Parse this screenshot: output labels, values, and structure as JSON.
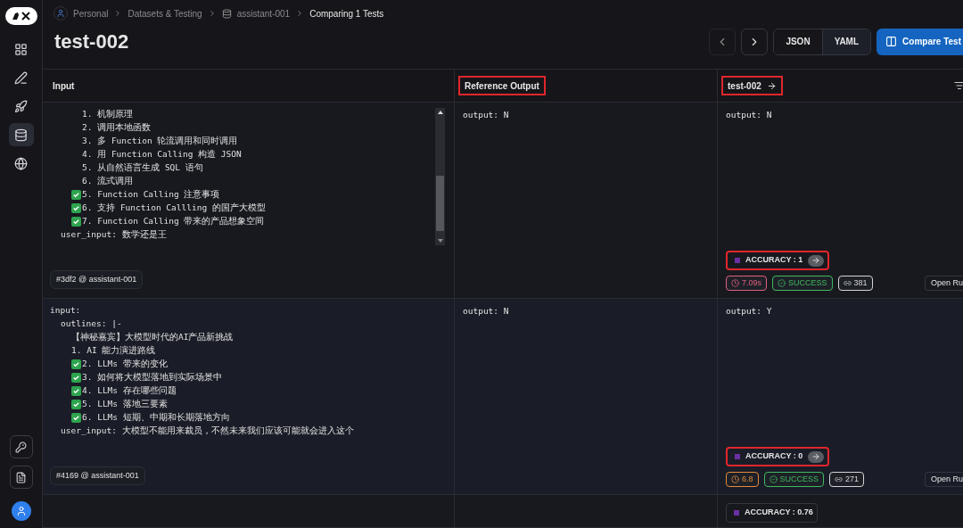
{
  "breadcrumb": [
    {
      "label": "Personal",
      "kind": "user"
    },
    {
      "label": "Datasets & Testing",
      "kind": "plain"
    },
    {
      "label": "assistant-001",
      "kind": "database"
    },
    {
      "label": "Comparing 1 Tests",
      "kind": "current"
    }
  ],
  "title": "test-002",
  "toolbar": {
    "formats": [
      {
        "label": "JSON",
        "selected": false
      },
      {
        "label": "YAML",
        "selected": true
      }
    ],
    "compare_button": "Compare Test"
  },
  "sidebar": {
    "top": [
      {
        "kind": "grid",
        "selected": false
      },
      {
        "kind": "pen",
        "selected": false
      },
      {
        "kind": "rocket",
        "selected": false
      },
      {
        "kind": "database",
        "selected": true
      },
      {
        "kind": "globe",
        "selected": false
      }
    ],
    "bottom": [
      {
        "kind": "key"
      },
      {
        "kind": "file"
      }
    ]
  },
  "columns": [
    {
      "label": "Input",
      "highlighted": false,
      "arrow": false
    },
    {
      "label": "Reference Output",
      "highlighted": true,
      "arrow": false
    },
    {
      "label": "test-002",
      "highlighted": true,
      "arrow": true
    }
  ],
  "rows": [
    {
      "input": [
        {
          "children": [
            {
              "children": [
                {
                  "children": [
                    {
                      "text": "1. 机制原理",
                      "checked": false
                    },
                    {
                      "text": "2. 调用本地函数",
                      "checked": false
                    },
                    {
                      "text": "3. 多 Function 轮流调用和同时调用",
                      "checked": false
                    },
                    {
                      "text": "4. 用 Function Calling 构造 JSON",
                      "checked": false
                    },
                    {
                      "text": "5. 从自然语言生成 SQL 语句",
                      "checked": false
                    },
                    {
                      "text": "6. 流式调用",
                      "checked": false
                    }
                  ]
                },
                {
                  "text": "5. Function Calling 注意事项",
                  "checked": true
                },
                {
                  "text": "6. 支持 Function Callling 的国产大模型",
                  "checked": true
                },
                {
                  "text": "7. Function Calling 带来的产品想象空间",
                  "checked": true
                }
              ]
            },
            {
              "text": "user_input: 数学还是王",
              "checked": false
            }
          ]
        }
      ],
      "scrollbar": true,
      "tag": "#3df2 @ assistant-001",
      "reference": "output: N",
      "output": "output: N",
      "accuracy": {
        "label": "ACCURACY : 1",
        "highlighted": true,
        "arrow": true
      },
      "stats": [
        {
          "kind": "latency",
          "text": "7.09s",
          "color": "#e0607e"
        },
        {
          "kind": "status",
          "text": "SUCCESS",
          "color": "#3fb95f"
        },
        {
          "kind": "tokens",
          "text": "381",
          "color": "#d4d4d8"
        }
      ],
      "open_run": "Open Ru"
    },
    {
      "input": [
        {
          "text": "input:",
          "checked": false,
          "children": [
            {
              "text": "outlines: |-",
              "checked": false,
              "children": [
                {
                  "text": "【神秘嘉宾】大模型时代的AI产品新挑战",
                  "checked": false
                },
                {
                  "text": "1. AI 能力演进路线",
                  "checked": false
                },
                {
                  "text": "2. LLMs 带来的变化",
                  "checked": true
                },
                {
                  "text": "3. 如何将大模型落地到实际场景中",
                  "checked": true
                },
                {
                  "text": "4. LLMs 存在哪些问题",
                  "checked": true
                },
                {
                  "text": "5. LLMs 落地三要素",
                  "checked": true
                },
                {
                  "text": "6. LLMs 短期、中期和长期落地方向",
                  "checked": true
                }
              ]
            },
            {
              "text": "user_input: 大模型不能用来裁员，不然未来我们应该可能就会进入这个",
              "checked": false
            }
          ]
        }
      ],
      "scrollbar": false,
      "tag": "#4169 @ assistant-001",
      "reference": "output: N",
      "output": "output: Y",
      "accuracy": {
        "label": "ACCURACY : 0",
        "highlighted": true,
        "arrow": true
      },
      "stats": [
        {
          "kind": "latency",
          "text": "6.8",
          "color": "#e08a3c"
        },
        {
          "kind": "status",
          "text": "SUCCESS",
          "color": "#3fb95f"
        },
        {
          "kind": "tokens",
          "text": "271",
          "color": "#d4d4d8"
        }
      ],
      "open_run": "Open Ru"
    },
    {
      "accuracy": {
        "label": "ACCURACY : 0.76",
        "highlighted": false,
        "arrow": false
      }
    }
  ]
}
